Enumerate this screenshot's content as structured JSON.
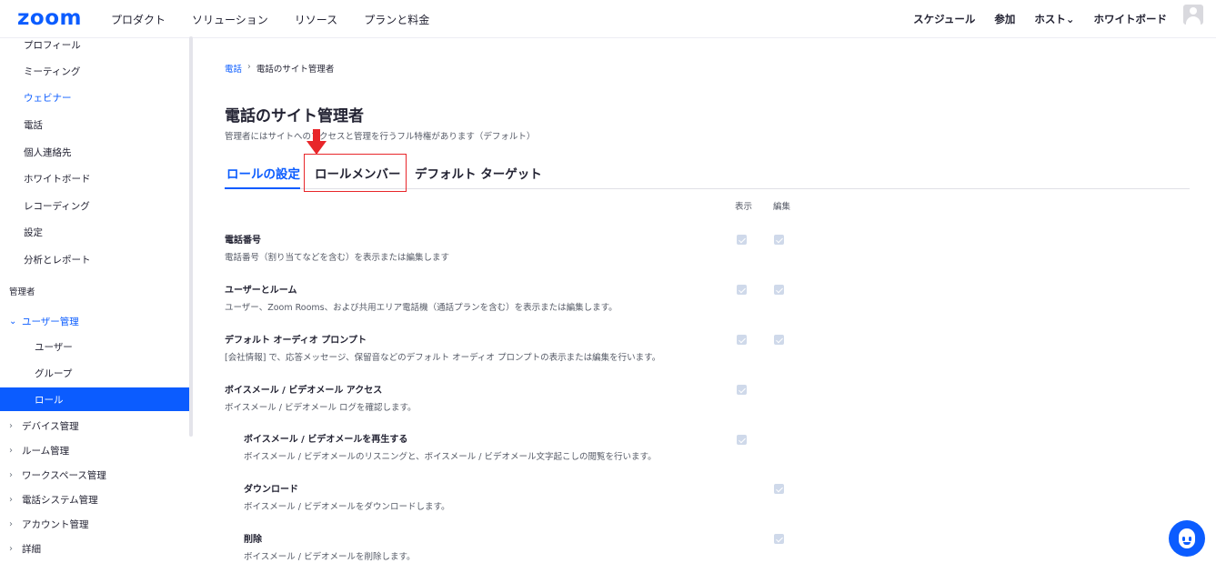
{
  "topnav": {
    "logo": "zoom",
    "left_items": [
      "プロダクト",
      "ソリューション",
      "リソース",
      "プランと料金"
    ],
    "right_items": [
      "スケジュール",
      "参加",
      "ホスト⌄",
      "ホワイトボード"
    ]
  },
  "sidebar": {
    "items": [
      {
        "label": "プロフィール"
      },
      {
        "label": "ミーティング"
      },
      {
        "label": "ウェビナー"
      },
      {
        "label": "電話"
      },
      {
        "label": "個人連絡先"
      },
      {
        "label": "ホワイトボード"
      },
      {
        "label": "レコーディング"
      },
      {
        "label": "設定"
      },
      {
        "label": "分析とレポート"
      }
    ],
    "section_admin": "管理者",
    "user_mgmt": {
      "label": "ユーザー管理",
      "children": [
        "ユーザー",
        "グループ",
        "ロール"
      ]
    },
    "groups": [
      "デバイス管理",
      "ルーム管理",
      "ワークスペース管理",
      "電話システム管理",
      "アカウント管理",
      "詳細"
    ]
  },
  "breadcrumb": {
    "link": "電話",
    "separator": "›",
    "current": "電話のサイト管理者"
  },
  "page": {
    "title": "電話のサイト管理者",
    "subtitle": "管理者にはサイトへのアクセスと管理を行うフル特権があります（デフォルト）"
  },
  "tabs": [
    "ロールの設定",
    "ロールメンバー",
    "デフォルト ターゲット"
  ],
  "columns": {
    "view": "表示",
    "edit": "編集"
  },
  "permissions": [
    {
      "title": "電話番号",
      "desc": "電話番号（割り当てなどを含む）を表示または編集します",
      "view": true,
      "edit": true
    },
    {
      "title": "ユーザーとルーム",
      "desc": "ユーザー、Zoom Rooms、および共用エリア電話機（通話プランを含む）を表示または編集します。",
      "view": true,
      "edit": true
    },
    {
      "title": "デフォルト オーディオ プロンプト",
      "desc": "[会社情報] で、応答メッセージ、保留音などのデフォルト オーディオ プロンプトの表示または編集を行います。",
      "view": true,
      "edit": true
    },
    {
      "title": "ボイスメール / ビデオメール アクセス",
      "desc": "ボイスメール / ビデオメール ログを確認します。",
      "view": true,
      "edit": false
    },
    {
      "title": "ボイスメール / ビデオメールを再生する",
      "desc": "ボイスメール / ビデオメールのリスニングと、ボイスメール / ビデオメール文字起こしの閲覧を行います。",
      "view": true,
      "edit": false
    },
    {
      "title": "ダウンロード",
      "desc": "ボイスメール / ビデオメールをダウンロードします。",
      "view": false,
      "edit": true
    },
    {
      "title": "削除",
      "desc": "ボイスメール / ビデオメールを削除します。",
      "view": false,
      "edit": true
    }
  ],
  "colors": {
    "brand": "#0b5cff",
    "annotation": "#e8262a"
  }
}
